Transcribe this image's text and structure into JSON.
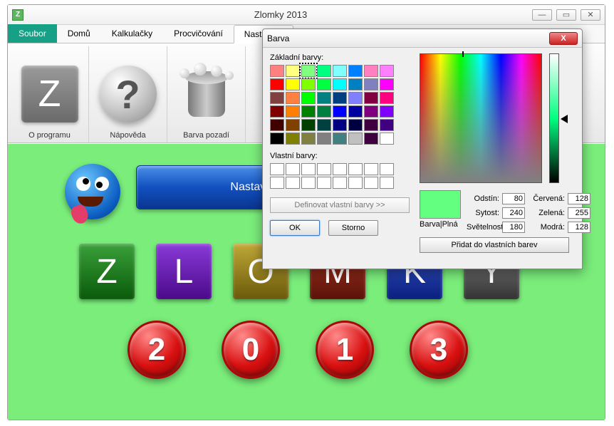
{
  "window": {
    "title": "Zlomky 2013",
    "icon_letter": "Z"
  },
  "menu": {
    "items": [
      "Soubor",
      "Domů",
      "Kalkulačky",
      "Procvičování",
      "Nastavení"
    ],
    "active_index": 4
  },
  "toolbar": {
    "items": [
      {
        "label": "O programu",
        "kind": "z"
      },
      {
        "label": "Nápověda",
        "kind": "q"
      },
      {
        "label": "Barva pozadí",
        "kind": "bucket"
      }
    ]
  },
  "content": {
    "banner": "Nastav si třeba svc",
    "letters": [
      {
        "char": "Z",
        "bg": "linear-gradient(#3aa03a,#0a5a0a)"
      },
      {
        "char": "L",
        "bg": "linear-gradient(#8a3ad8,#4a0a8a)"
      },
      {
        "char": "O",
        "bg": "linear-gradient(#c0a838,#6a5a0a)"
      },
      {
        "char": "M",
        "bg": "linear-gradient(#b03a28,#5a1208)"
      },
      {
        "char": "K",
        "bg": "linear-gradient(#3a58c8,#0a2080)"
      },
      {
        "char": "Y",
        "bg": "linear-gradient(#888,#333)"
      }
    ],
    "year": [
      "2",
      "0",
      "1",
      "3"
    ]
  },
  "color_dialog": {
    "title": "Barva",
    "basic_label": "Základní barvy:",
    "custom_label": "Vlastní barvy:",
    "define_btn": "Definovat vlastní barvy >>",
    "ok": "OK",
    "cancel": "Storno",
    "preview_label": "Barva|Plná",
    "add_btn": "Přidat do vlastních barev",
    "labels": {
      "hue": "Odstín:",
      "sat": "Sytost:",
      "lum": "Světelnost:",
      "red": "Červená:",
      "green": "Zelená:",
      "blue": "Modrá:"
    },
    "values": {
      "hue": "80",
      "sat": "240",
      "lum": "180",
      "red": "128",
      "green": "255",
      "blue": "128"
    },
    "selected_basic_index": 2,
    "basic_colors": [
      "#ff8080",
      "#ffff80",
      "#80ff80",
      "#00ff80",
      "#80ffff",
      "#0080ff",
      "#ff80c0",
      "#ff80ff",
      "#ff0000",
      "#ffff00",
      "#80ff00",
      "#00ff40",
      "#00ffff",
      "#0080c0",
      "#8080c0",
      "#ff00ff",
      "#804040",
      "#ff8040",
      "#00ff00",
      "#008080",
      "#004080",
      "#8080ff",
      "#800040",
      "#ff0080",
      "#800000",
      "#ff8000",
      "#008000",
      "#008040",
      "#0000ff",
      "#0000a0",
      "#800080",
      "#8000ff",
      "#400000",
      "#804000",
      "#004000",
      "#004040",
      "#000080",
      "#000040",
      "#400040",
      "#400080",
      "#000000",
      "#808000",
      "#808040",
      "#808080",
      "#408080",
      "#c0c0c0",
      "#400040",
      "#ffffff"
    ]
  }
}
